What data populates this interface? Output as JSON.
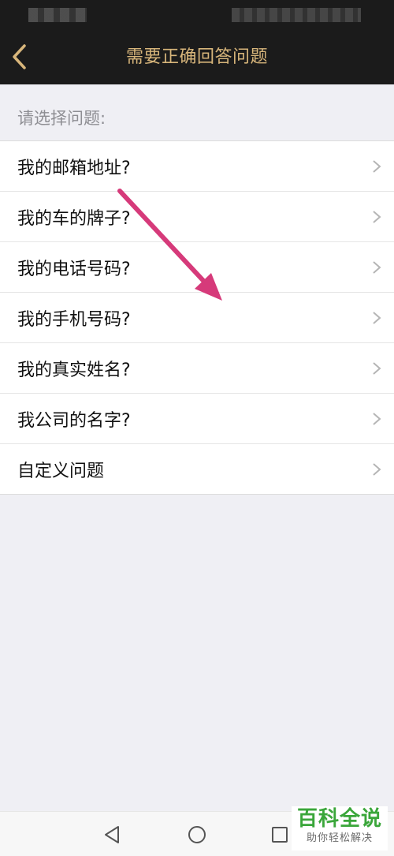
{
  "header": {
    "title": "需要正确回答问题",
    "back_icon": "chevron-left-icon",
    "accent_color": "#d8b67b"
  },
  "section": {
    "label": "请选择问题:"
  },
  "questions": [
    {
      "label": "我的邮箱地址?"
    },
    {
      "label": "我的车的牌子?"
    },
    {
      "label": "我的电话号码?"
    },
    {
      "label": "我的手机号码?"
    },
    {
      "label": "我的真实姓名?"
    },
    {
      "label": "我公司的名字?"
    },
    {
      "label": "自定义问题"
    }
  ],
  "annotation": {
    "arrow_color": "#d63a7a"
  },
  "watermark": {
    "title": "百科全说",
    "subtitle": "助你轻松解决"
  },
  "nav_icons": [
    "triangle-back-icon",
    "circle-home-icon",
    "square-recent-icon"
  ]
}
